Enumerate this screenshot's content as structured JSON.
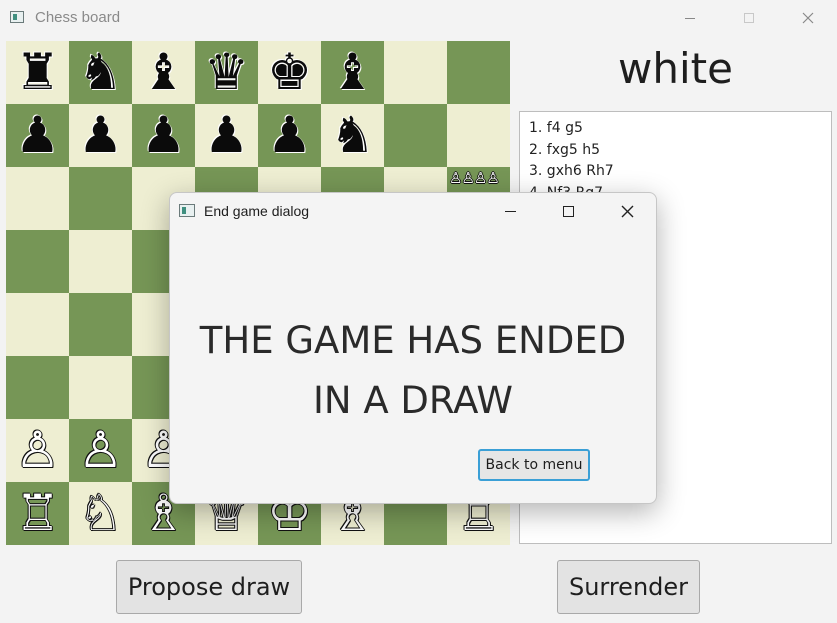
{
  "window": {
    "title": "Chess board",
    "controls": {
      "minimize": "minimize",
      "maximize": "maximize",
      "close": "close"
    }
  },
  "board": {
    "light_color": "#eeeed2",
    "dark_color": "#769656",
    "ranks": [
      [
        "♜",
        "♞",
        "♝",
        "♛",
        "♚",
        "♝",
        "",
        ""
      ],
      [
        "♟",
        "♟",
        "♟",
        "♟",
        "♟",
        "♞",
        "",
        ""
      ],
      [
        "",
        "",
        "",
        "",
        "",
        "",
        "",
        "♙♙♙♙"
      ],
      [
        "",
        "",
        "",
        "",
        "",
        "",
        "",
        ""
      ],
      [
        "",
        "",
        "",
        "",
        "",
        "",
        "",
        ""
      ],
      [
        "",
        "",
        "",
        "",
        "",
        "",
        "",
        ""
      ],
      [
        "♙",
        "♙",
        "♙",
        "",
        "",
        "",
        "",
        ""
      ],
      [
        "♖",
        "♘",
        "♗",
        "♕",
        "♔",
        "♗",
        "",
        "♖"
      ]
    ],
    "piece_colors": [
      [
        "black",
        "black",
        "black",
        "black",
        "black",
        "black",
        "",
        ""
      ],
      [
        "black",
        "black",
        "black",
        "black",
        "black",
        "black",
        "",
        ""
      ],
      [
        "",
        "",
        "",
        "",
        "",
        "",
        "",
        "white-mini"
      ],
      [
        "",
        "",
        "",
        "",
        "",
        "",
        "",
        ""
      ],
      [
        "",
        "",
        "",
        "",
        "",
        "",
        "",
        ""
      ],
      [
        "",
        "",
        "",
        "",
        "",
        "",
        "",
        ""
      ],
      [
        "white",
        "white",
        "white",
        "",
        "",
        "",
        "",
        ""
      ],
      [
        "white",
        "white",
        "white",
        "white",
        "white",
        "white",
        "",
        "white"
      ]
    ]
  },
  "turn_label": "white",
  "moves": [
    "1. f4 g5",
    "2. fxg5 h5",
    "3. gxh6 Rh7",
    "4. Nf3 Rg7"
  ],
  "buttons": {
    "propose_draw": "Propose draw",
    "surrender": "Surrender"
  },
  "dialog": {
    "title": "End game dialog",
    "message_line1": "THE GAME HAS ENDED",
    "message_line2": "IN A DRAW",
    "button": "Back to menu",
    "focus_color": "#3a9fd6"
  }
}
